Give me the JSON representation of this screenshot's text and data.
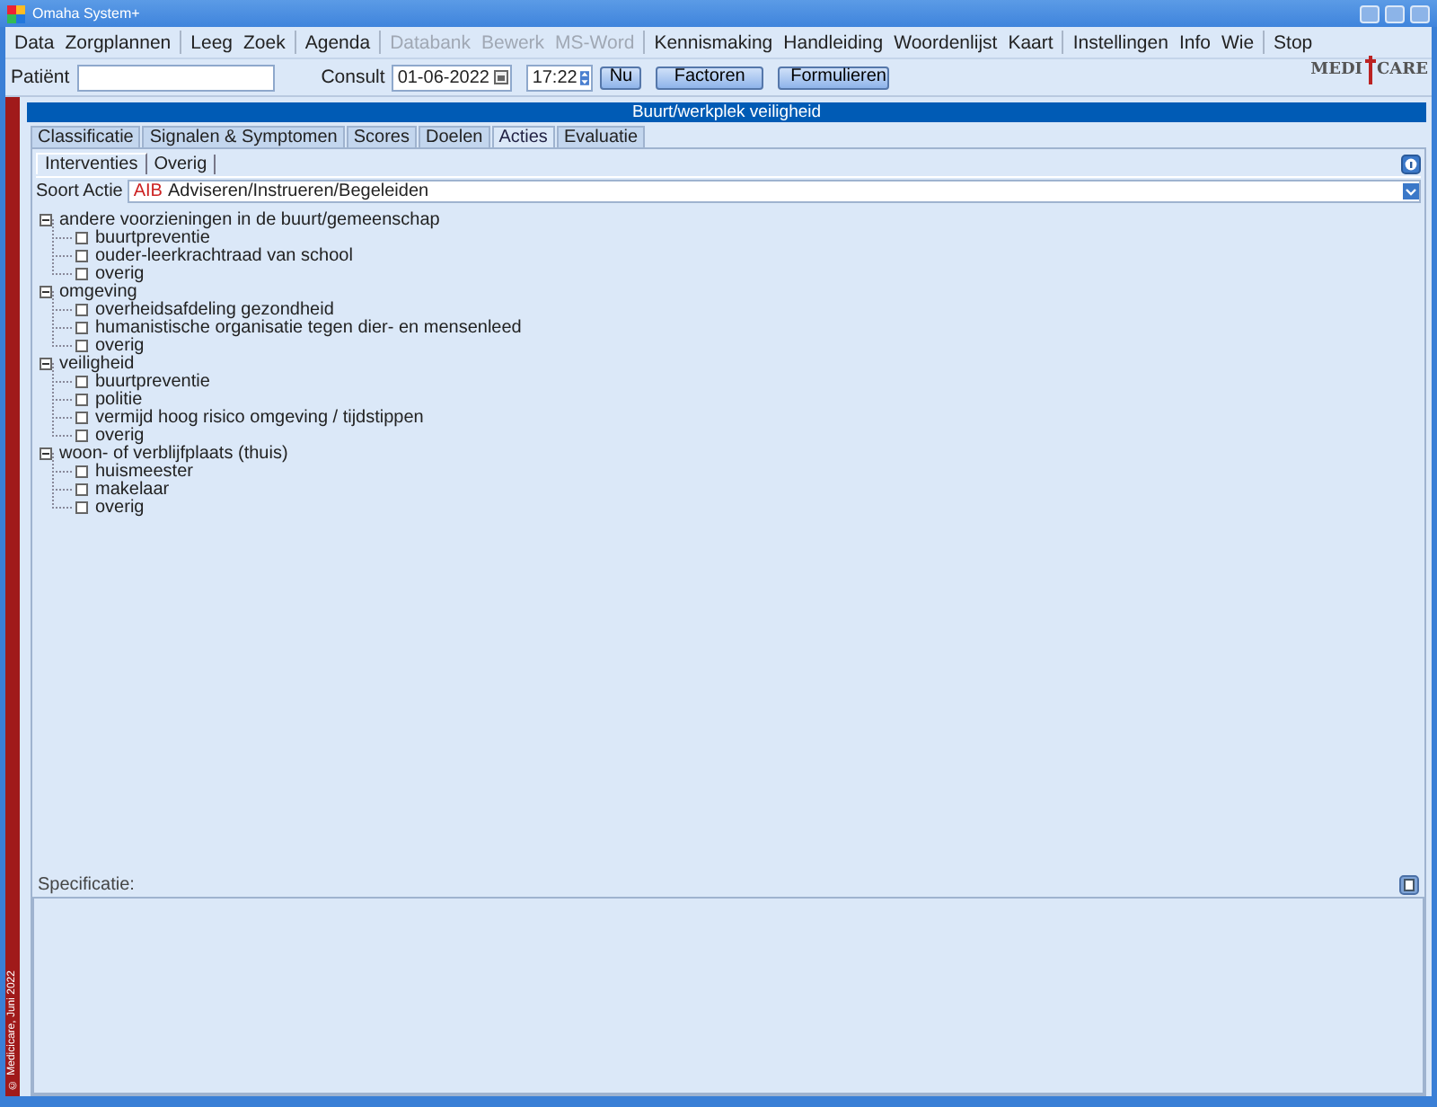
{
  "window": {
    "title": "Omaha System+"
  },
  "menu_groups": [
    {
      "items": [
        {
          "label": "Data",
          "disabled": false
        },
        {
          "label": "Zorgplannen",
          "disabled": false
        }
      ]
    },
    {
      "items": [
        {
          "label": "Leeg",
          "disabled": false
        },
        {
          "label": "Zoek",
          "disabled": false
        }
      ]
    },
    {
      "items": [
        {
          "label": "Agenda",
          "disabled": false
        }
      ]
    },
    {
      "items": [
        {
          "label": "Databank",
          "disabled": true
        },
        {
          "label": "Bewerk",
          "disabled": true
        },
        {
          "label": "MS-Word",
          "disabled": true
        }
      ]
    },
    {
      "items": [
        {
          "label": "Kennismaking",
          "disabled": false
        },
        {
          "label": "Handleiding",
          "disabled": false
        },
        {
          "label": "Woordenlijst",
          "disabled": false
        },
        {
          "label": "Kaart",
          "disabled": false
        }
      ]
    },
    {
      "items": [
        {
          "label": "Instellingen",
          "disabled": false
        },
        {
          "label": "Info",
          "disabled": false
        },
        {
          "label": "Wie",
          "disabled": false
        }
      ]
    },
    {
      "items": [
        {
          "label": "Stop",
          "disabled": false
        }
      ]
    }
  ],
  "toolbar": {
    "patient_label": "Patiënt",
    "consult_label": "Consult",
    "date": "01-06-2022",
    "time": "17:22",
    "now_button": "Nu",
    "buttons": [
      "Factoren",
      "Formulieren"
    ]
  },
  "logo": {
    "left": "MEDI",
    "right": "CARE"
  },
  "sidebar_text": "© Medicicare, Juni 2022",
  "header": "Buurt/werkplek veiligheid",
  "tabs": [
    {
      "label": "Classificatie",
      "selected": false
    },
    {
      "label": "Signalen & Symptomen",
      "selected": false
    },
    {
      "label": "Scores",
      "selected": false
    },
    {
      "label": "Doelen",
      "selected": false
    },
    {
      "label": "Acties",
      "selected": true
    },
    {
      "label": "Evaluatie",
      "selected": false
    }
  ],
  "subtabs": [
    {
      "label": "Interventies",
      "selected": true
    },
    {
      "label": "Overig",
      "selected": false
    }
  ],
  "soort_actie": {
    "label": "Soort Actie",
    "code": "AIB",
    "value": "Adviseren/Instrueren/Begeleiden"
  },
  "tree": [
    {
      "label": "andere voorzieningen in de buurt/gemeenschap",
      "expanded": true,
      "children": [
        {
          "label": "buurtpreventie",
          "checked": false
        },
        {
          "label": "ouder-leerkrachtraad van school",
          "checked": false
        },
        {
          "label": "overig",
          "checked": false
        }
      ]
    },
    {
      "label": "omgeving",
      "expanded": true,
      "children": [
        {
          "label": "overheidsafdeling gezondheid",
          "checked": false
        },
        {
          "label": "humanistische organisatie tegen dier- en mensenleed",
          "checked": false
        },
        {
          "label": "overig",
          "checked": false
        }
      ]
    },
    {
      "label": "veiligheid",
      "expanded": true,
      "children": [
        {
          "label": "buurtpreventie",
          "checked": false
        },
        {
          "label": "politie",
          "checked": false
        },
        {
          "label": "vermijd hoog risico omgeving / tijdstippen",
          "checked": false
        },
        {
          "label": "overig",
          "checked": false
        }
      ]
    },
    {
      "label": "woon- of verblijfplaats (thuis)",
      "expanded": true,
      "children": [
        {
          "label": "huismeester",
          "checked": false
        },
        {
          "label": "makelaar",
          "checked": false
        },
        {
          "label": "overig",
          "checked": false
        }
      ]
    }
  ],
  "specificatie": {
    "label": "Specificatie:"
  }
}
